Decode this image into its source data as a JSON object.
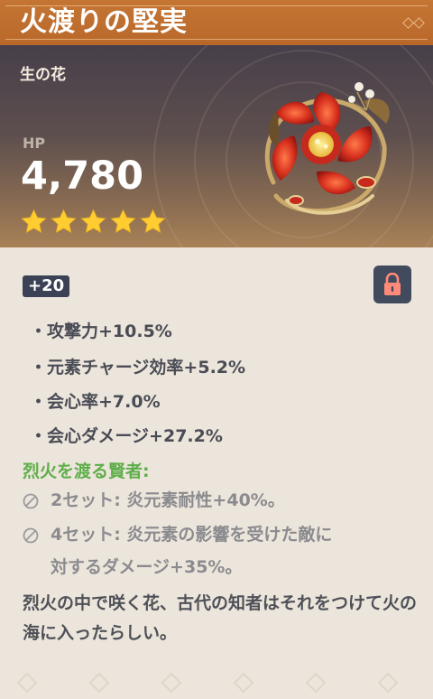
{
  "artifact": {
    "name": "火渡りの堅実",
    "slot": "生の花",
    "main_stat_label": "HP",
    "main_stat_value": "4,780",
    "rarity": 5,
    "level": "+20",
    "locked": true
  },
  "substats": [
    "・攻撃力+10.5%",
    "・元素チャージ効率+5.2%",
    "・会心率+7.0%",
    "・会心ダメージ+27.2%"
  ],
  "set": {
    "name": "烈火を渡る賢者:",
    "bonuses": [
      {
        "line1": "2セット: 炎元素耐性+40%。",
        "line2": ""
      },
      {
        "line1": "4セット: 炎元素の影響を受けた敵に",
        "line2": "対するダメージ+35%。"
      }
    ]
  },
  "description": "烈火の中で咲く花、古代の知者はそれをつけて火の海に入ったらしい。",
  "colors": {
    "title_bar": "#c47533",
    "header_top": "#463f4a",
    "header_bottom": "#a88157",
    "body_bg": "#ece5db",
    "set_name": "#5fae4a",
    "star": "#ffcc32",
    "level_badge": "#3b4255",
    "lock_icon": "#ff8a7a"
  },
  "icons": {
    "star": "star-icon",
    "lock": "lock-icon",
    "set_inactive": "prohibited-circle-icon",
    "artifact_art": "red-flower-artifact-icon"
  }
}
